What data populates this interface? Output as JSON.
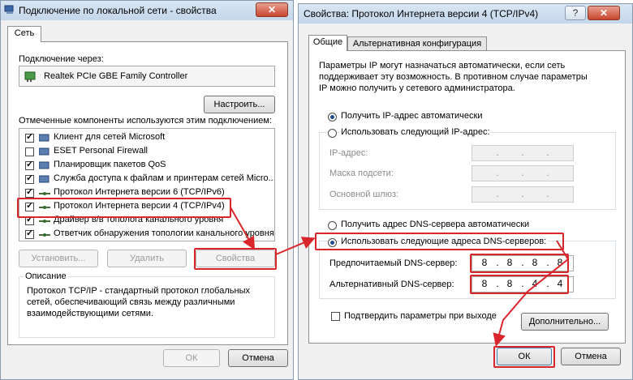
{
  "left_window": {
    "title": "Подключение по локальной сети - свойства",
    "close_label": "✕",
    "tab": "Сеть",
    "connect_via_label": "Подключение через:",
    "adapter": "Realtek PCIe GBE Family Controller",
    "configure_button": "Настроить...",
    "components_label": "Отмеченные компоненты используются этим подключением:",
    "components": [
      {
        "label": "Клиент для сетей Microsoft",
        "checked": true
      },
      {
        "label": "ESET Personal Firewall",
        "checked": false
      },
      {
        "label": "Планировщик пакетов QoS",
        "checked": true
      },
      {
        "label": "Служба доступа к файлам и принтерам сетей Micro...",
        "checked": true
      },
      {
        "label": "Протокол Интернета версии 6 (TCP/IPv6)",
        "checked": true
      },
      {
        "label": "Протокол Интернета версии 4 (TCP/IPv4)",
        "checked": true
      },
      {
        "label": "Драйвер в/в тополога канального уровня",
        "checked": true
      },
      {
        "label": "Ответчик обнаружения топологии канального уровня",
        "checked": true
      }
    ],
    "install_button": "Установить...",
    "remove_button": "Удалить",
    "properties_button": "Свойства",
    "description_label": "Описание",
    "description_text": [
      "Протокол TCP/IP - стандартный протокол глобальных",
      "сетей, обеспечивающий связь между различными",
      "взаимодействующими сетями."
    ],
    "ok_button": "ОК",
    "cancel_button": "Отмена"
  },
  "right_window": {
    "title": "Свойства: Протокол Интернета версии 4 (TCP/IPv4)",
    "help_label": "?",
    "close_label": "✕",
    "tabs": [
      "Общие",
      "Альтернативная конфигурация"
    ],
    "intro_text": [
      "Параметры IP могут назначаться автоматически, если сеть",
      "поддерживает эту возможность. В противном случае параметры",
      "IP можно получить у сетевого администратора."
    ],
    "radio_ip_auto": "Получить IP-адрес автоматически",
    "radio_ip_manual": "Использовать следующий IP-адрес:",
    "ip_label": "IP-адрес:",
    "mask_label": "Маска подсети:",
    "gateway_label": "Основной шлюз:",
    "radio_dns_auto": "Получить адрес DNS-сервера автоматически",
    "radio_dns_manual": "Использовать следующие адреса DNS-серверов:",
    "preferred_dns_label": "Предпочитаемый DNS-сервер:",
    "preferred_dns": [
      "8",
      "8",
      "8",
      "8"
    ],
    "alternate_dns_label": "Альтернативный DNS-сервер:",
    "alternate_dns": [
      "8",
      "8",
      "4",
      "4"
    ],
    "validate_label": "Подтвердить параметры при выходе",
    "advanced_button": "Дополнительно...",
    "ok_button": "ОК",
    "cancel_button": "Отмена"
  },
  "colors": {
    "highlight": "#d9262c",
    "window_bg": "#f0f0f0",
    "titlebar": "#c4d6ea"
  }
}
